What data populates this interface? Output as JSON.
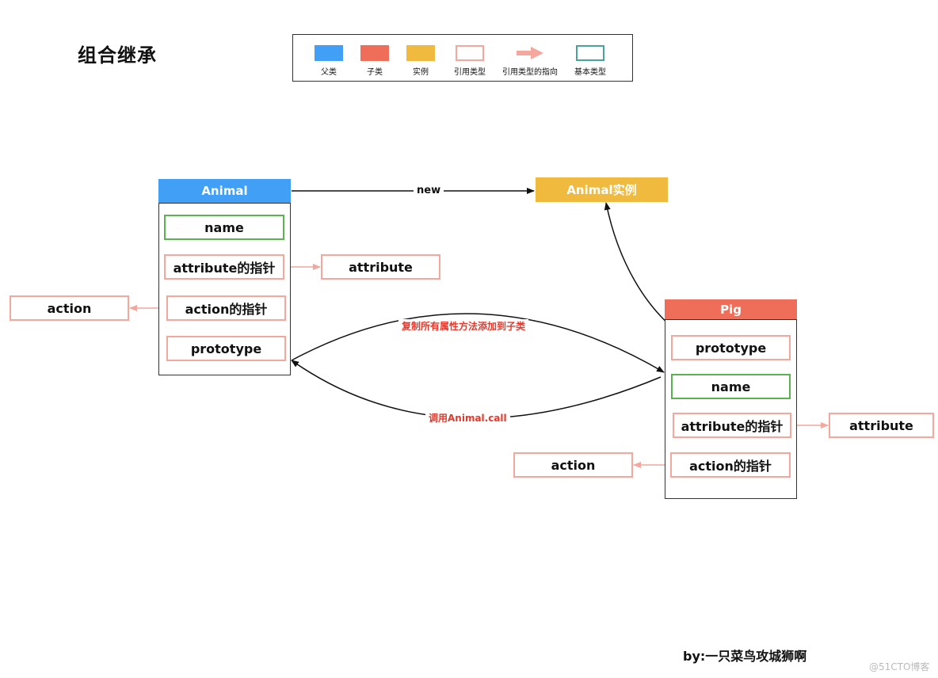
{
  "title": "组合继承",
  "legend": {
    "items": [
      {
        "label": "父类",
        "kind": "parent-class",
        "color": "#419ff5"
      },
      {
        "label": "子类",
        "kind": "child-class",
        "color": "#ef6e5a"
      },
      {
        "label": "实例",
        "kind": "instance",
        "color": "#efba3e"
      },
      {
        "label": "引用类型",
        "kind": "reference-type",
        "color": "#f3a79d"
      },
      {
        "label": "引用类型的指向",
        "kind": "reference-arrow",
        "color": "#f3a79d"
      },
      {
        "label": "基本类型",
        "kind": "primitive-type",
        "color": "#4aa39a"
      }
    ]
  },
  "animal": {
    "header": "Animal",
    "fields": [
      "name",
      "attribute的指针",
      "action的指针",
      "prototype"
    ],
    "attribute_target": "attribute",
    "action_target": "action"
  },
  "instance": {
    "label": "Animal实例"
  },
  "pig": {
    "header": "Pig",
    "fields": [
      "prototype",
      "name",
      "attribute的指针",
      "action的指针"
    ],
    "attribute_target": "attribute",
    "action_target": "action"
  },
  "edges": {
    "new": "new",
    "copy": "复制所有属性方法添加到子类",
    "call": "调用Animal.call"
  },
  "footer": {
    "author": "by:一只菜鸟攻城狮啊",
    "watermark": "@51CTO博客"
  }
}
